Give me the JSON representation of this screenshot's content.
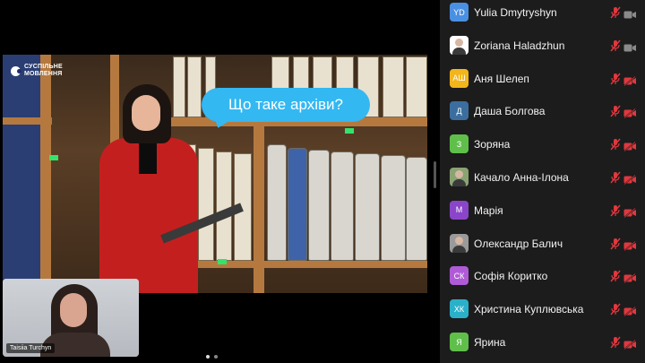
{
  "slide": {
    "logo_line1": "СУСПІЛЬНЕ",
    "logo_line2": "МОВЛЕННЯ",
    "bubble_text": "Що таке архіви?"
  },
  "self_view": {
    "name": "Taisiia Turchyn"
  },
  "pager": {
    "count": 2,
    "active": 1
  },
  "colors": {
    "muted_red": "#e0383e",
    "cam_off_red": "#e0383e",
    "cam_on_gray": "#8a8a8a"
  },
  "participants": [
    {
      "initials": "YD",
      "avatar_color": "#4a90e2",
      "name": "Yulia Dmytryshyn",
      "photo": false,
      "mic": "muted",
      "cam": "on"
    },
    {
      "initials": "",
      "avatar_color": "#ffffff",
      "name": "Zoriana Haladzhun",
      "photo": true,
      "mic": "muted",
      "cam": "on"
    },
    {
      "initials": "АШ",
      "avatar_color": "#f2b51b",
      "name": "Аня Шелеп",
      "photo": false,
      "mic": "muted",
      "cam": "off"
    },
    {
      "initials": "Д",
      "avatar_color": "#3b6e9e",
      "name": "Даша Болгова",
      "photo": false,
      "mic": "muted",
      "cam": "off"
    },
    {
      "initials": "З",
      "avatar_color": "#5fbf4a",
      "name": "Зоряна",
      "photo": false,
      "mic": "muted",
      "cam": "off"
    },
    {
      "initials": "",
      "avatar_color": "#8aa372",
      "name": "Качало Анна-Ілона",
      "photo": true,
      "mic": "muted",
      "cam": "off"
    },
    {
      "initials": "М",
      "avatar_color": "#8a45c9",
      "name": "Марія",
      "photo": false,
      "mic": "muted",
      "cam": "off"
    },
    {
      "initials": "",
      "avatar_color": "#9a9a9a",
      "name": "Олександр Балич",
      "photo": true,
      "mic": "muted",
      "cam": "off"
    },
    {
      "initials": "СК",
      "avatar_color": "#b05bd6",
      "name": "Софія Коритко",
      "photo": false,
      "mic": "muted",
      "cam": "off"
    },
    {
      "initials": "ХК",
      "avatar_color": "#2bb0c9",
      "name": "Христина Куплювська",
      "photo": false,
      "mic": "muted",
      "cam": "off"
    },
    {
      "initials": "Я",
      "avatar_color": "#5fbf4a",
      "name": "Ярина",
      "photo": false,
      "mic": "muted",
      "cam": "off"
    }
  ]
}
